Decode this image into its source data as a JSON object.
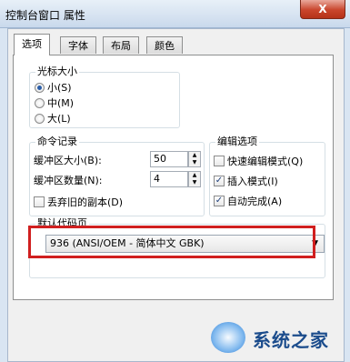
{
  "window": {
    "title": "控制台窗口 属性",
    "close_label": "X"
  },
  "tabs": [
    "选项",
    "字体",
    "布局",
    "颜色"
  ],
  "cursor_size": {
    "title": "光标大小",
    "options": [
      "小(S)",
      "中(M)",
      "大(L)"
    ],
    "selected": "小(S)"
  },
  "command_history": {
    "title": "命令记录",
    "buffer_size_label": "缓冲区大小(B):",
    "buffer_size_value": "50",
    "buffer_count_label": "缓冲区数量(N):",
    "buffer_count_value": "4",
    "discard_old_label": "丢弃旧的副本(D)",
    "discard_old_checked": false
  },
  "edit_options": {
    "title": "编辑选项",
    "quick_edit_label": "快速编辑模式(Q)",
    "quick_edit_checked": false,
    "insert_mode_label": "插入模式(I)",
    "insert_mode_checked": true,
    "auto_complete_label": "自动完成(A)",
    "auto_complete_checked": true
  },
  "code_page": {
    "title": "默认代码页",
    "selected": "936  (ANSI/OEM - 简体中文 GBK)"
  },
  "icons": {
    "radio_selected": "radio-dot",
    "check": "✓",
    "spin_up": "▲",
    "spin_down": "▼",
    "dropdown": "▼"
  },
  "watermark": {
    "text": "系统之家"
  },
  "colors": {
    "highlight": "#d01f1f",
    "title_bar": "#c9d9ec"
  }
}
